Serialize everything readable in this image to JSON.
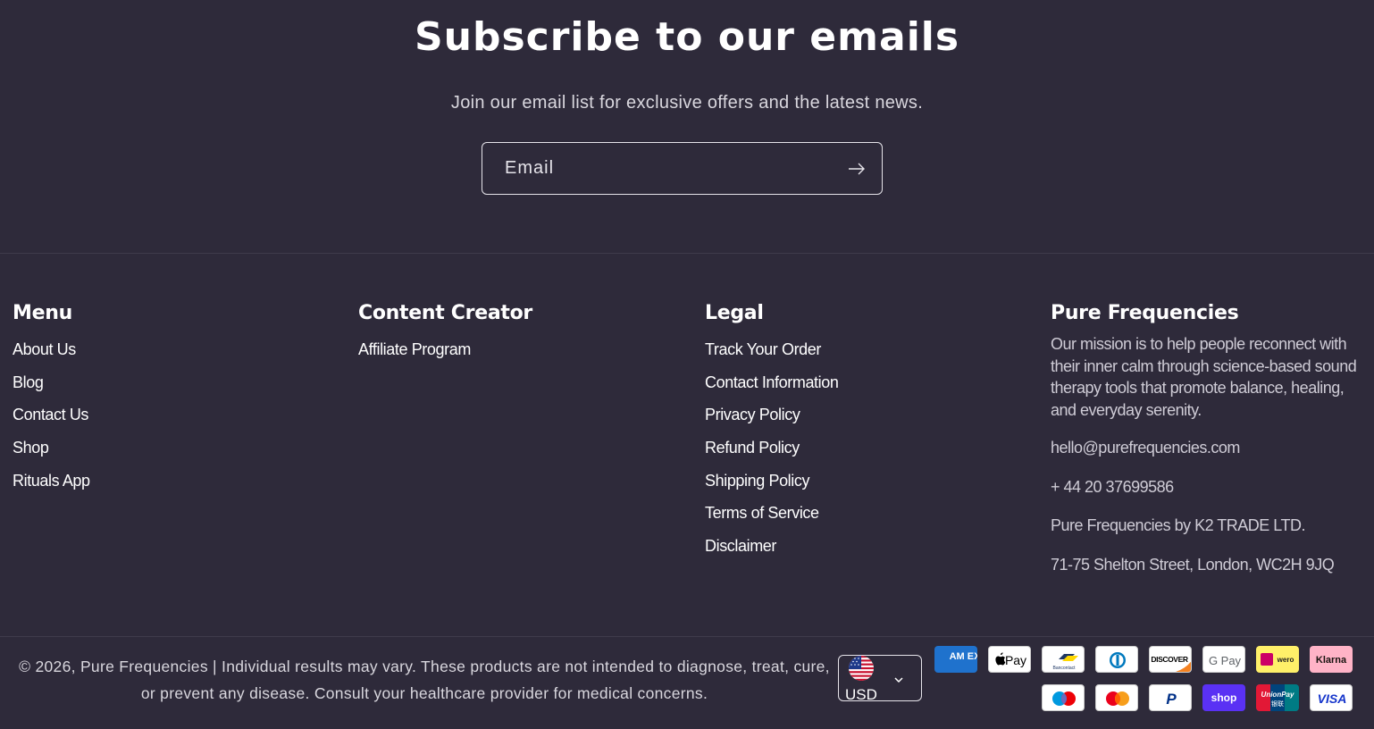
{
  "newsletter": {
    "title": "Subscribe to our emails",
    "subtitle": "Join our email list for exclusive offers and the latest news.",
    "email_placeholder": "Email",
    "submit_icon": "arrow-right-icon"
  },
  "footer": {
    "menu": {
      "heading": "Menu",
      "links": [
        "About Us",
        "Blog",
        "Contact Us",
        "Shop",
        "Rituals App"
      ]
    },
    "content_creator": {
      "heading": "Content Creator",
      "links": [
        "Affiliate Program"
      ]
    },
    "legal": {
      "heading": "Legal",
      "links": [
        "Track Your Order",
        "Contact Information",
        "Privacy Policy",
        "Refund Policy",
        "Shipping Policy",
        "Terms of Service",
        "Disclaimer"
      ]
    },
    "about": {
      "heading": "Pure Frequencies",
      "mission": "Our mission is to help people reconnect with their inner calm through science-based sound therapy tools that promote balance, healing, and everyday serenity.",
      "email": "hello@purefrequencies.com",
      "phone": "+ 44 20 37699586",
      "company": "Pure Frequencies by K2 TRADE LTD.",
      "address": "71-75 Shelton Street, London, WC2H 9JQ"
    }
  },
  "bottom": {
    "copyright": "© 2026, Pure Frequencies | Individual results may vary. These products are not intended to diagnose, treat, cure, or prevent any disease. Consult your healthcare provider for medical concerns.",
    "currency": {
      "label": "USD",
      "flag_icon": "us-flag-icon",
      "chevron_icon": "chevron-down-icon"
    },
    "payment_methods": {
      "amex": "AM EX",
      "apple_pay": "Pay",
      "bancontact": "Bancontact",
      "diners": "diners-club-icon",
      "discover": "DISCOVER",
      "google_pay": "G Pay",
      "ideal_wero": "wero",
      "klarna": "Klarna",
      "maestro": "maestro-icon",
      "mastercard": "mastercard-icon",
      "paypal": "P",
      "shop_pay": "shop",
      "unionpay": "UnionPay",
      "unionpay_cn": "银联",
      "visa": "VISA"
    }
  },
  "colors": {
    "background": "#2e2a3a",
    "text": "#ffffff",
    "muted_text": "#cfccd6",
    "divider": "#3f3b4b"
  }
}
